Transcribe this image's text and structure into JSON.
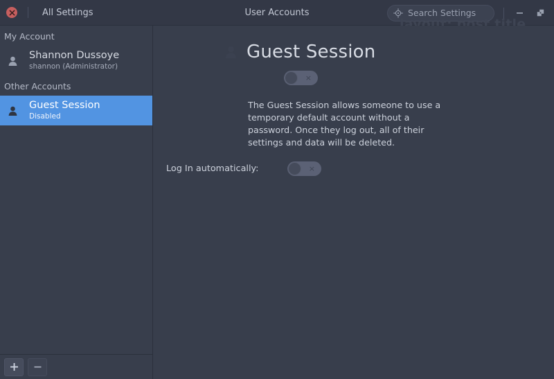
{
  "titlebar": {
    "close_icon": "close-icon",
    "all_settings_label": "All Settings",
    "window_title": "User Accounts",
    "search_icon": "search-target-icon",
    "search_placeholder": "Search Settings",
    "minimize_icon": "minimize-icon",
    "maximize_icon": "maximize-restore-icon",
    "watermark_text": "layout: post title"
  },
  "sidebar": {
    "groups": [
      {
        "header": "My Account",
        "accounts": [
          {
            "name": "Shannon Dussoye",
            "sub": "shannon   (Administrator)",
            "selected": false
          }
        ]
      },
      {
        "header": "Other Accounts",
        "accounts": [
          {
            "name": "Guest Session",
            "sub": "Disabled",
            "selected": true
          }
        ]
      }
    ],
    "toolbar": {
      "add_label": "+",
      "remove_label": "–"
    }
  },
  "main": {
    "title": "Guest Session",
    "avatar_icon": "person-icon",
    "enable_toggle": {
      "state": "off",
      "mark": "×"
    },
    "description": "The Guest Session allows someone to use a temporary default account without a password. Once they log out, all of their settings and data will be deleted.",
    "autologin": {
      "label": "Log In automatically:",
      "toggle_state": "off",
      "mark": "×"
    }
  },
  "colors": {
    "window_bg": "#383e4c",
    "titlebar_bg": "#333846",
    "accent_selected": "#5294e2",
    "close_red": "#c75f5f",
    "text_primary": "#d7dbe3",
    "text_secondary": "#a6acba"
  }
}
